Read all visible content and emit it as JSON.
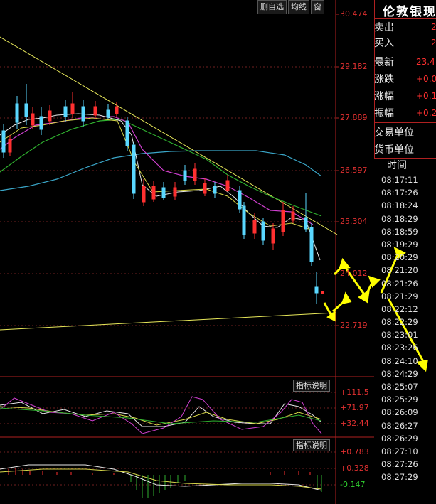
{
  "toolbar": {
    "delete_watch": "删自选",
    "ma_lines": "均线",
    "window": "窗"
  },
  "main_axis": {
    "labels": [
      "30.474",
      "29.182",
      "27.889",
      "26.597",
      "25.304",
      "24.012",
      "22.719"
    ]
  },
  "info": {
    "title": "伦敦银现",
    "sell_label": "卖出",
    "sell_value": "2",
    "buy_label": "买入",
    "buy_value": "2",
    "latest_label": "最新",
    "latest_value": "23.4",
    "change_label": "涨跌",
    "change_value": "+0.0",
    "change_pct_label": "涨幅",
    "change_pct_value": "+0.1",
    "amplitude_label": "振幅",
    "amplitude_value": "+0.2",
    "trade_unit_label": "交易单位",
    "currency_unit_label": "货币单位"
  },
  "times": {
    "header": "时间",
    "items": [
      "08:17:11",
      "08:17:26",
      "08:18:24",
      "08:18:29",
      "08:18:59",
      "08:19:29",
      "08:20:29",
      "08:21:20",
      "08:21:26",
      "08:21:29",
      "08:22:12",
      "08:22:29",
      "08:23:01",
      "08:23:26",
      "08:24:10",
      "08:24:29",
      "08:25:07",
      "08:25:29",
      "08:26:09",
      "08:26:27",
      "08:26:29",
      "08:27:10",
      "08:27:26",
      "08:27:29"
    ]
  },
  "indicator1": {
    "button": "指标说明",
    "labels": [
      "+111.5",
      "+71.97",
      "+32.44"
    ]
  },
  "indicator2": {
    "button": "指标说明",
    "labels": [
      "+0.783",
      "+0.328",
      "-0.147"
    ]
  },
  "colors": {
    "up": "#5ad8ff",
    "down": "#ff3030",
    "annotation": "#ffff00"
  }
}
